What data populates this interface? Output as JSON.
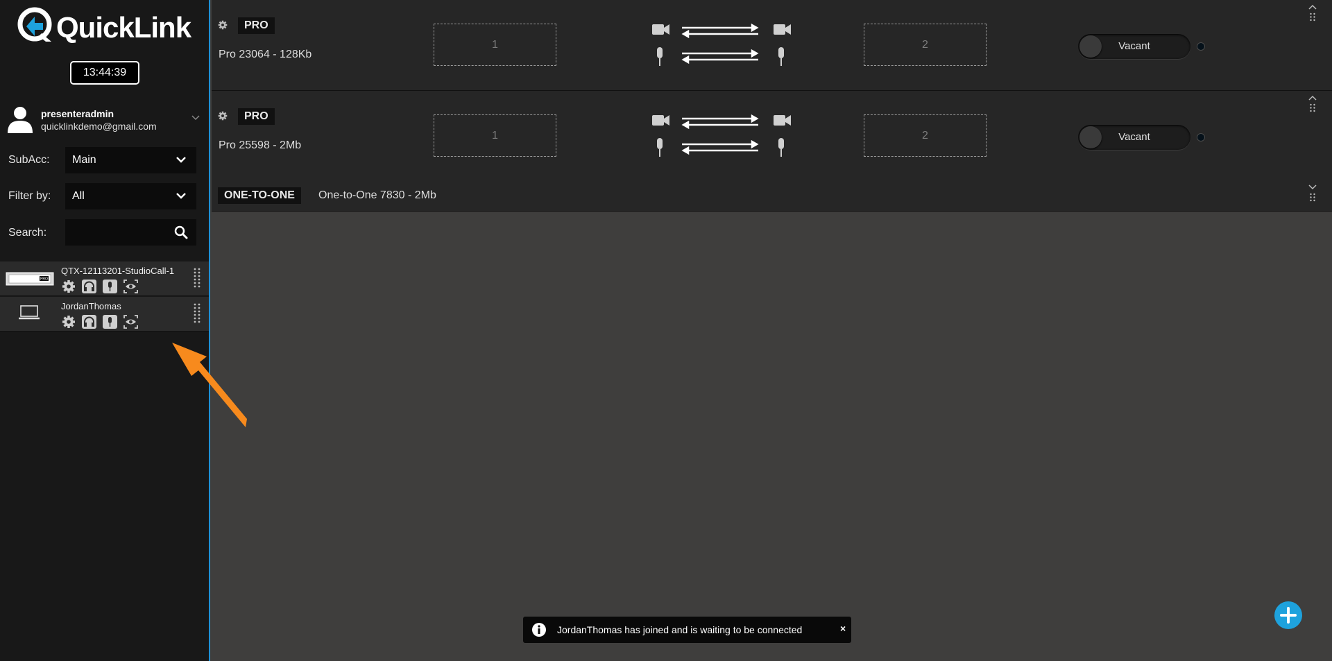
{
  "sidebar": {
    "brand": "QuickLink",
    "clock": "13:44:39",
    "user": {
      "name": "presenteradmin",
      "email": "quicklinkdemo@gmail.com"
    },
    "subacc": {
      "label": "SubAcc:",
      "value": "Main"
    },
    "filter": {
      "label": "Filter by:",
      "value": "All"
    },
    "search": {
      "label": "Search:",
      "placeholder": ""
    },
    "devices": [
      {
        "name": "QTX-12113201-StudioCall-1",
        "badge": "PRO",
        "icon": "pro-hardware-unit-icon"
      },
      {
        "name": "JordanThomas",
        "icon": "laptop-icon"
      }
    ]
  },
  "rows": [
    {
      "tag": "PRO",
      "name": "Pro 23064 - 128Kb",
      "slot1": "1",
      "slot2": "2",
      "status": "Vacant"
    },
    {
      "tag": "PRO",
      "name": "Pro 25598 - 2Mb",
      "slot1": "1",
      "slot2": "2",
      "status": "Vacant"
    }
  ],
  "one_to_one": {
    "tag": "ONE-TO-ONE",
    "name": "One-to-One 7830 - 2Mb"
  },
  "toast": {
    "message": "JordanThomas has joined and is waiting to be connected",
    "close": "×"
  },
  "colors": {
    "accent": "#1ea2dd",
    "arrow": "#f78a1d",
    "sidebar_border": "#1e8fd6"
  }
}
